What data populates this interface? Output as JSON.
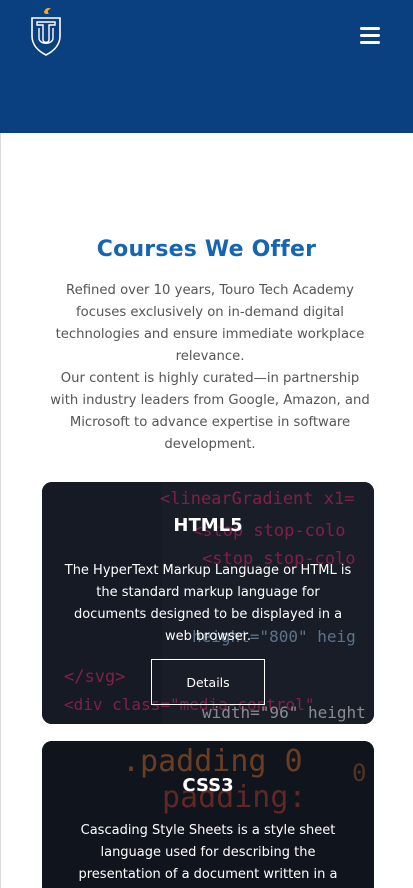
{
  "header": {
    "logo_icon": "touro-tu-shield-logo",
    "menu_icon": "hamburger-menu-icon",
    "background_color": "#0a3f80"
  },
  "courses": {
    "heading": "Courses We Offer",
    "intro_paragraph_1": "Refined over 10 years, Touro Tech Academy focuses exclusively on in-demand digital technologies and ensure immediate workplace relevance.",
    "intro_paragraph_2": "Our content is highly curated—in partnership with industry leaders from Google, Amazon, and Microsoft to advance expertise in software development.",
    "heading_color": "#1565b3"
  },
  "cards": [
    {
      "title": "HTML5",
      "description": "The HyperText Markup Language or HTML is the standard markup language for documents designed to be displayed in a web browser.",
      "button_label": "Details",
      "code_lines": [
        "<linearGradient x1=",
        "<stop stop-colo",
        "<stop stop-colo",
        "height=\"800\" heig",
        "</svg>",
        "<div class=\"media-control\"",
        "width=\"96\" height"
      ]
    },
    {
      "title": "CSS3",
      "description": "Cascading Style Sheets is a style sheet language used for describing the presentation of a document written in a",
      "code_lines": [
        ".padding 0",
        "padding:",
        "0"
      ]
    }
  ]
}
